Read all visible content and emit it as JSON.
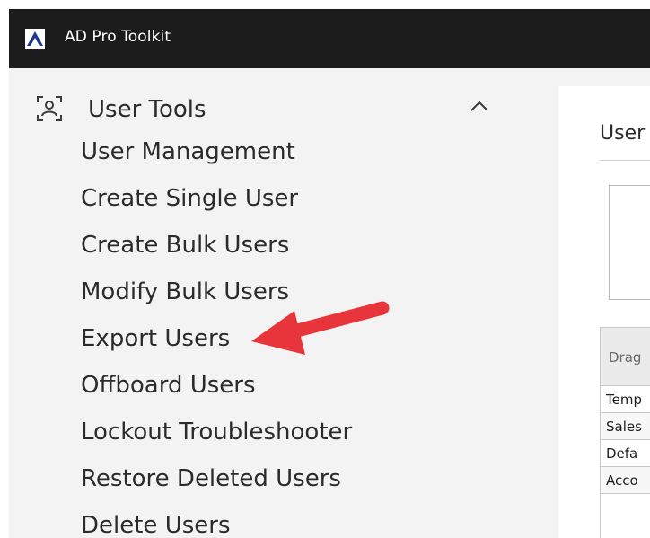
{
  "app": {
    "title": "AD Pro Toolkit",
    "titlebar_color": "#1c1c1c",
    "logo_icon": "ad-pro-logo-icon"
  },
  "sidebar": {
    "group": {
      "label": "User Tools",
      "icon": "user-scan-icon",
      "expanded": true,
      "toggle_icon": "chevron-up-icon"
    },
    "items": [
      {
        "label": "User Management"
      },
      {
        "label": "Create Single User"
      },
      {
        "label": "Create Bulk Users"
      },
      {
        "label": "Modify Bulk Users"
      },
      {
        "label": "Export Users"
      },
      {
        "label": "Offboard Users"
      },
      {
        "label": "Lockout Troubleshooter"
      },
      {
        "label": "Restore Deleted Users"
      },
      {
        "label": "Delete Users"
      }
    ]
  },
  "annotation": {
    "arrow_target": "Export Users",
    "arrow_color": "#e8353b"
  },
  "main": {
    "heading": "User",
    "grid": {
      "header": "Drag",
      "rows": [
        "Temp",
        "Sales",
        "Defa",
        "Acco"
      ]
    }
  }
}
